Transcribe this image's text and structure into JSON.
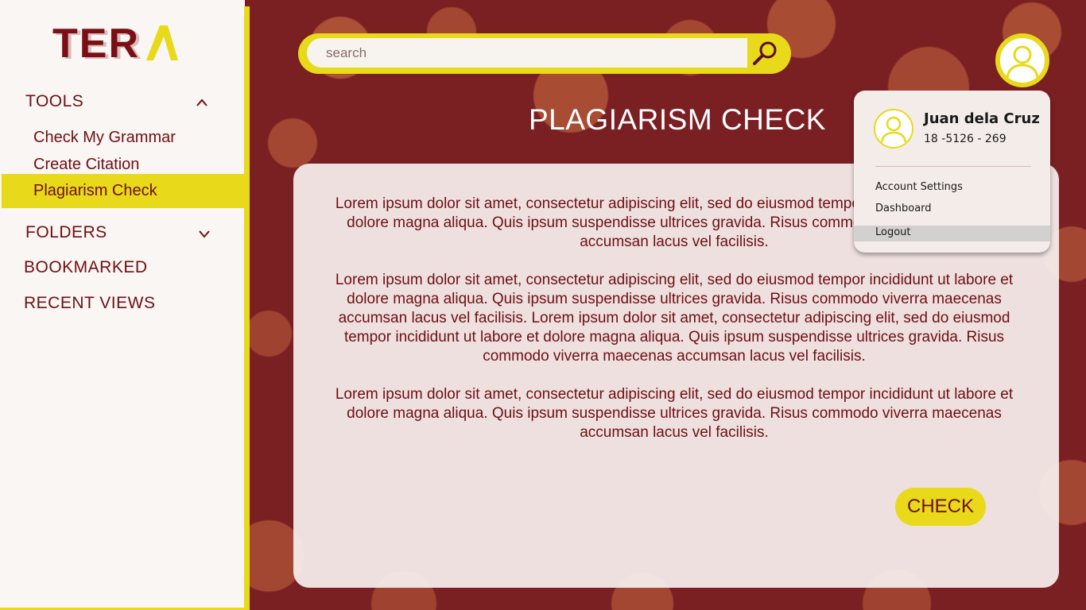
{
  "app": {
    "logo_text": "TERA"
  },
  "sidebar": {
    "tools": {
      "label": "TOOLS",
      "expanded": true,
      "items": [
        {
          "label": "Check My Grammar",
          "active": false
        },
        {
          "label": "Create Citation",
          "active": false
        },
        {
          "label": "Plagiarism Check",
          "active": true
        }
      ]
    },
    "folders": {
      "label": "FOLDERS",
      "expanded": false
    },
    "bookmarked": {
      "label": "BOOKMARKED"
    },
    "recent": {
      "label": "RECENT VIEWS"
    }
  },
  "search": {
    "placeholder": "search",
    "icon": "search-icon"
  },
  "main": {
    "title": "PLAGIARISM CHECK",
    "paragraphs": [
      "Lorem ipsum dolor sit amet, consectetur adipiscing elit, sed do eiusmod tempor incididunt ut labore et dolore magna aliqua. Quis ipsum suspendisse ultrices gravida. Risus commodo viverra maecenas accumsan lacus vel facilisis.",
      "Lorem ipsum dolor sit amet, consectetur adipiscing elit, sed do eiusmod tempor incididunt ut labore et dolore magna aliqua. Quis ipsum suspendisse ultrices gravida. Risus commodo viverra maecenas accumsan lacus vel facilisis. Lorem ipsum dolor sit amet, consectetur adipiscing elit, sed do eiusmod tempor incididunt ut labore et dolore magna aliqua. Quis ipsum suspendisse ultrices gravida. Risus commodo viverra maecenas accumsan lacus vel facilisis.",
      "Lorem ipsum dolor sit amet, consectetur adipiscing elit, sed do eiusmod tempor incididunt ut labore et dolore magna aliqua. Quis ipsum suspendisse ultrices gravida. Risus commodo viverra maecenas accumsan lacus vel facilisis."
    ],
    "check_label": "CHECK"
  },
  "user_menu": {
    "name": "Juan dela Cruz",
    "id": "18 -5126 - 269",
    "items": [
      {
        "label": "Account Settings"
      },
      {
        "label": "Dashboard"
      },
      {
        "label": "Logout"
      }
    ]
  },
  "colors": {
    "maroon": "#7a1f22",
    "accent_yellow": "#e8d91a",
    "text_maroon": "#6e0f14",
    "sidebar_bg": "#f9f6f3"
  }
}
